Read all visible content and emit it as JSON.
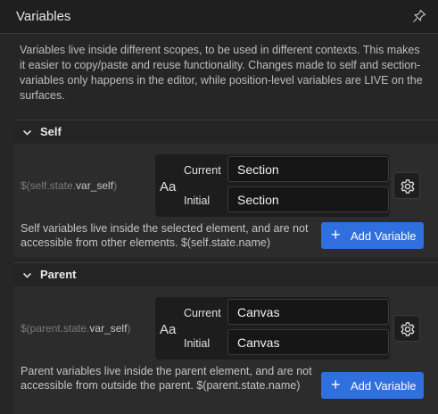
{
  "header": {
    "title": "Variables",
    "pin_icon": "pin-icon"
  },
  "intro": "Variables live inside different scopes, to be used in different contexts. This makes it easier to copy/paste and reuse functionality. Changes made to self and section-variables only happens in the editor, while position-level variables are LIVE on the surfaces.",
  "sections": [
    {
      "title": "Self",
      "path_prefix": "$(self.state.",
      "path_var": "var_self",
      "path_suffix": ")",
      "type_icon": "Aa",
      "current_label": "Current",
      "current_value": "Section",
      "initial_label": "Initial",
      "initial_value": "Section",
      "description": "Self variables live inside the selected element, and are not accessible from other elements. $(self.state.name)",
      "add_label": "Add Variable"
    },
    {
      "title": "Parent",
      "path_prefix": "$(parent.state.",
      "path_var": "var_self",
      "path_suffix": ")",
      "type_icon": "Aa",
      "current_label": "Current",
      "current_value": "Canvas",
      "initial_label": "Initial",
      "initial_value": "Canvas",
      "description": "Parent variables live inside the parent element, and are not accessible from outside the parent. $(parent.state.name)",
      "add_label": "Add Variable"
    }
  ],
  "colors": {
    "accent": "#2f6fde",
    "background": "#262626",
    "input_bg": "#161616"
  }
}
